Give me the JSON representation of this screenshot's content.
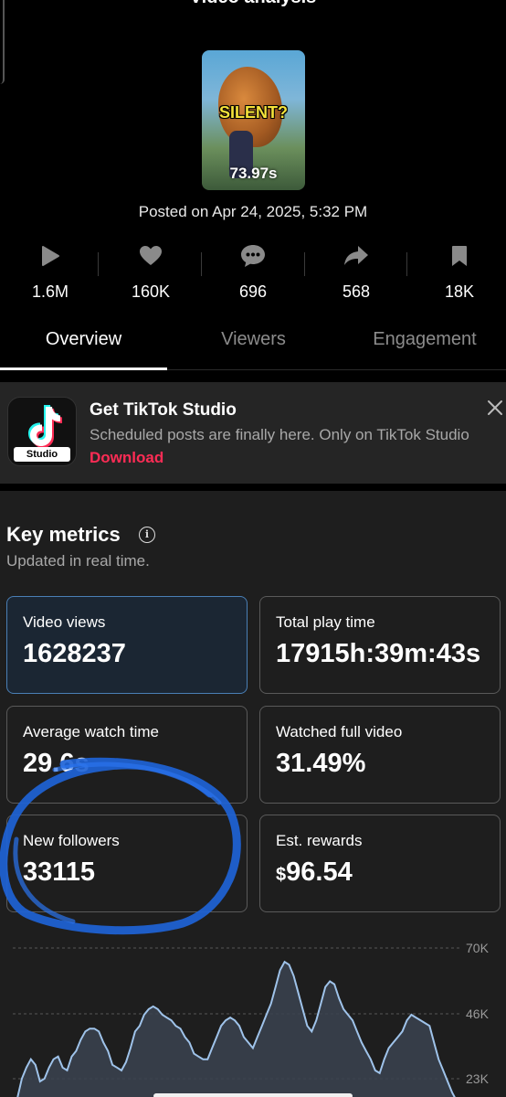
{
  "header": {
    "title": "Video analysis",
    "thumbnail": {
      "overlay_text": "SILENT?",
      "duration": "73.97s"
    },
    "posted": "Posted on Apr 24, 2025, 5:32 PM"
  },
  "stats": [
    {
      "icon": "play-icon",
      "value": "1.6M"
    },
    {
      "icon": "heart-icon",
      "value": "160K"
    },
    {
      "icon": "comment-icon",
      "value": "696"
    },
    {
      "icon": "share-icon",
      "value": "568"
    },
    {
      "icon": "bookmark-icon",
      "value": "18K"
    }
  ],
  "tabs": [
    {
      "label": "Overview",
      "active": true
    },
    {
      "label": "Viewers",
      "active": false
    },
    {
      "label": "Engagement",
      "active": false
    }
  ],
  "banner": {
    "title": "Get TikTok Studio",
    "description": "Scheduled posts are finally here. Only on TikTok Studio",
    "link": "Download",
    "icon_label": "Studio"
  },
  "key_metrics": {
    "title": "Key metrics",
    "subtitle": "Updated in real time.",
    "cards": [
      {
        "label": "Video views",
        "value": "1628237",
        "selected": true
      },
      {
        "label": "Total play time",
        "value": "17915h:39m:43s",
        "selected": false
      },
      {
        "label": "Average watch time",
        "value": "29.6s",
        "selected": false
      },
      {
        "label": "Watched full video",
        "value": "31.49%",
        "selected": false
      },
      {
        "label": "New followers",
        "value": "33115",
        "selected": false
      },
      {
        "label": "Est. rewards",
        "currency": "$",
        "value": "96.54",
        "selected": false
      }
    ]
  },
  "chart_data": {
    "type": "area",
    "y_ticks": [
      "70K",
      "46K",
      "23K"
    ],
    "ylim": [
      0,
      70000
    ],
    "values": [
      15000,
      16000,
      23000,
      27000,
      30000,
      28000,
      22000,
      23000,
      27000,
      30000,
      31000,
      27000,
      26000,
      31000,
      33000,
      37000,
      40000,
      41000,
      41000,
      40000,
      36000,
      33000,
      28000,
      27000,
      26000,
      29000,
      34000,
      40000,
      42000,
      46000,
      48000,
      49000,
      48000,
      46000,
      45000,
      44000,
      42000,
      41000,
      38000,
      36000,
      32000,
      31000,
      30000,
      30000,
      34000,
      38000,
      42000,
      44000,
      45000,
      44000,
      42000,
      38000,
      36000,
      34000,
      38000,
      42000,
      46000,
      50000,
      56000,
      62000,
      65000,
      64000,
      60000,
      54000,
      48000,
      42000,
      40000,
      44000,
      50000,
      56000,
      58000,
      57000,
      52000,
      48000,
      46000,
      44000,
      40000,
      36000,
      33000,
      30000,
      26000,
      25000,
      30000,
      34000,
      36000,
      38000,
      40000,
      44000,
      46000,
      45000,
      44000,
      43000,
      42000,
      36000,
      30000,
      26000,
      22000,
      18000,
      15000,
      14000
    ]
  }
}
